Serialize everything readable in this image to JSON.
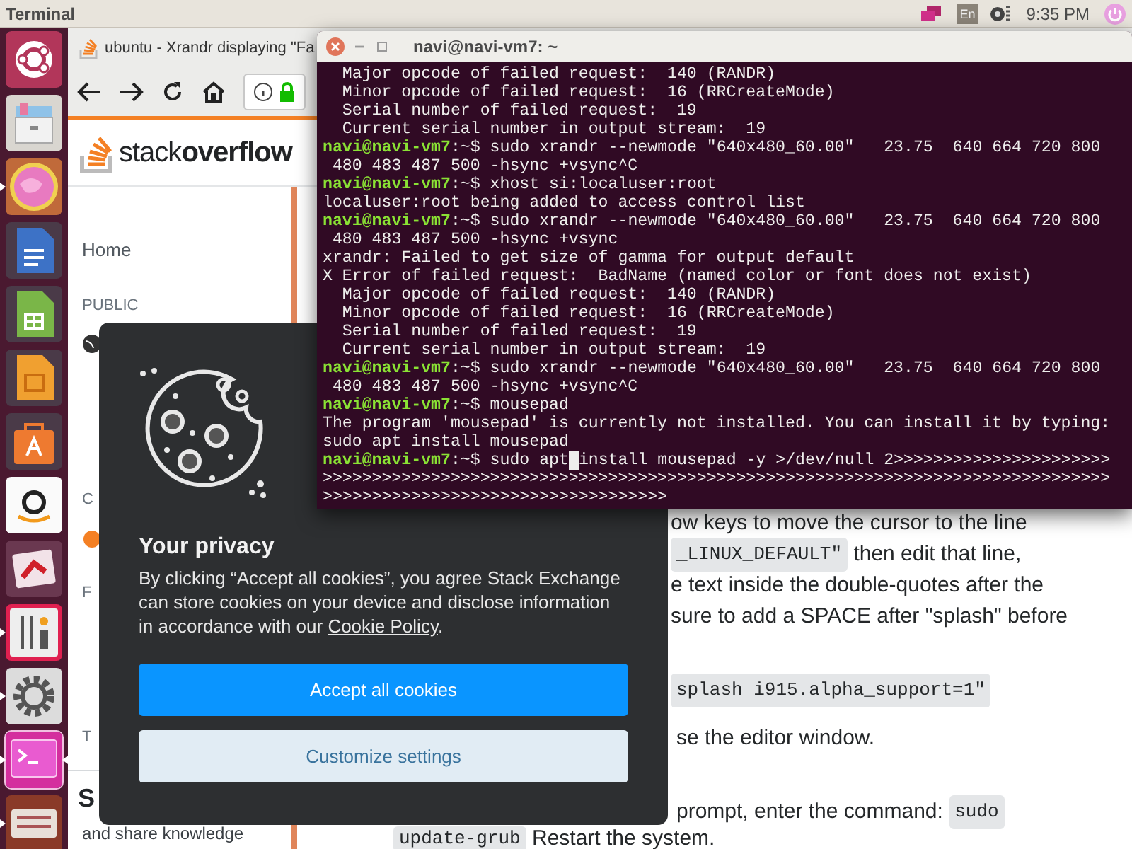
{
  "top_bar": {
    "app_name": "Terminal",
    "keyboard_layout": "En",
    "clock": "9:35 PM"
  },
  "launcher": {
    "items": [
      {
        "running": false,
        "active": false
      },
      {
        "running": false,
        "active": false
      },
      {
        "running": true,
        "active": false
      },
      {
        "running": false,
        "active": false
      },
      {
        "running": false,
        "active": false
      },
      {
        "running": false,
        "active": false
      },
      {
        "running": false,
        "active": false
      },
      {
        "running": false,
        "active": false
      },
      {
        "running": false,
        "active": false
      },
      {
        "running": true,
        "active": false
      },
      {
        "running": true,
        "active": false
      },
      {
        "running": true,
        "active": true
      },
      {
        "running": true,
        "active": false
      }
    ]
  },
  "browser": {
    "tab_title": "ubuntu - Xrandr displaying \"Fa",
    "logo": "stack**overflow**",
    "sidebar": {
      "home": "Home",
      "section": "PUBLIC",
      "partial_labels": [
        "C",
        "F",
        "T"
      ],
      "teams_heading": "S",
      "teams_text": "and share knowledge"
    },
    "paragraphs": [
      [
        [
          {
            "kind": "text",
            "text": "ow keys to move the cursor to the line"
          }
        ],
        [
          {
            "kind": "code",
            "text": "_LINUX_DEFAULT\""
          },
          {
            "kind": "text",
            "text": " then edit that line,"
          }
        ],
        [
          {
            "kind": "text",
            "text": "e text inside the double-quotes after the"
          }
        ],
        [
          {
            "kind": "text",
            "text": "sure to add a SPACE after \"splash\" before"
          }
        ]
      ],
      [
        [
          {
            "kind": "code",
            "text": "splash i915.alpha_support=1\""
          }
        ]
      ],
      [
        [
          {
            "kind": "text",
            "text": "se the editor window."
          }
        ]
      ],
      [
        [
          {
            "kind": "text",
            "text": "prompt, enter the command: "
          },
          {
            "kind": "code",
            "text": "sudo"
          }
        ],
        [
          {
            "kind": "code",
            "text": "update-grub"
          },
          {
            "kind": "text",
            "text": " Restart the system."
          }
        ]
      ]
    ]
  },
  "terminal": {
    "title": "navi@navi-vm7: ~",
    "lines": [
      {
        "kind": "output",
        "text": "  Major opcode of failed request:  140 (RANDR)"
      },
      {
        "kind": "output",
        "text": "  Minor opcode of failed request:  16 (RRCreateMode)"
      },
      {
        "kind": "output",
        "text": "  Serial number of failed request:  19"
      },
      {
        "kind": "output",
        "text": "  Current serial number in output stream:  19"
      },
      {
        "kind": "prompt",
        "prompt": "navi@navi-vm7",
        "path": ":~$ ",
        "text": "sudo xrandr --newmode \"640x480_60.00\"   23.75  640 664 720 800"
      },
      {
        "kind": "output",
        "text": " 480 483 487 500 -hsync +vsync^C"
      },
      {
        "kind": "prompt",
        "prompt": "navi@navi-vm7",
        "path": ":~$ ",
        "text": "xhost si:localuser:root"
      },
      {
        "kind": "output",
        "text": "localuser:root being added to access control list"
      },
      {
        "kind": "prompt",
        "prompt": "navi@navi-vm7",
        "path": ":~$ ",
        "text": "sudo xrandr --newmode \"640x480_60.00\"   23.75  640 664 720 800"
      },
      {
        "kind": "output",
        "text": " 480 483 487 500 -hsync +vsync"
      },
      {
        "kind": "output",
        "text": "xrandr: Failed to get size of gamma for output default"
      },
      {
        "kind": "output",
        "text": "X Error of failed request:  BadName (named color or font does not exist)"
      },
      {
        "kind": "output",
        "text": "  Major opcode of failed request:  140 (RANDR)"
      },
      {
        "kind": "output",
        "text": "  Minor opcode of failed request:  16 (RRCreateMode)"
      },
      {
        "kind": "output",
        "text": "  Serial number of failed request:  19"
      },
      {
        "kind": "output",
        "text": "  Current serial number in output stream:  19"
      },
      {
        "kind": "prompt",
        "prompt": "navi@navi-vm7",
        "path": ":~$ ",
        "text": "sudo xrandr --newmode \"640x480_60.00\"   23.75  640 664 720 800"
      },
      {
        "kind": "output",
        "text": " 480 483 487 500 -hsync +vsync^C"
      },
      {
        "kind": "prompt",
        "prompt": "navi@navi-vm7",
        "path": ":~$ ",
        "text": "mousepad"
      },
      {
        "kind": "output",
        "text": "The program 'mousepad' is currently not installed. You can install it by typing:"
      },
      {
        "kind": "output",
        "text": "sudo apt install mousepad"
      },
      {
        "kind": "prompt",
        "prompt": "navi@navi-vm7",
        "path": ":~$ ",
        "text": "sudo apt",
        "after_cursor": "install mousepad -y >/dev/null 2>>>>>>>>>>>>>>>>>>>>>>"
      },
      {
        "kind": "output",
        "text": ">>>>>>>>>>>>>>>>>>>>>>>>>>>>>>>>>>>>>>>>>>>>>>>>>>>>>>>>>>>>>>>>>>>>>>>>>>>>>>>>"
      },
      {
        "kind": "output",
        "text": ">>>>>>>>>>>>>>>>>>>>>>>>>>>>>>>>>>>"
      }
    ]
  },
  "cookie_dialog": {
    "title": "Your privacy",
    "body": "By clicking “Accept all cookies”, you agree Stack Exchange can store cookies on your device and disclose information in accordance with our ",
    "link": "Cookie Policy",
    "body_end": ".",
    "buttons": [
      {
        "label": "Accept all cookies",
        "kind": "primary"
      },
      {
        "label": "Customize settings",
        "kind": "secondary"
      }
    ]
  }
}
